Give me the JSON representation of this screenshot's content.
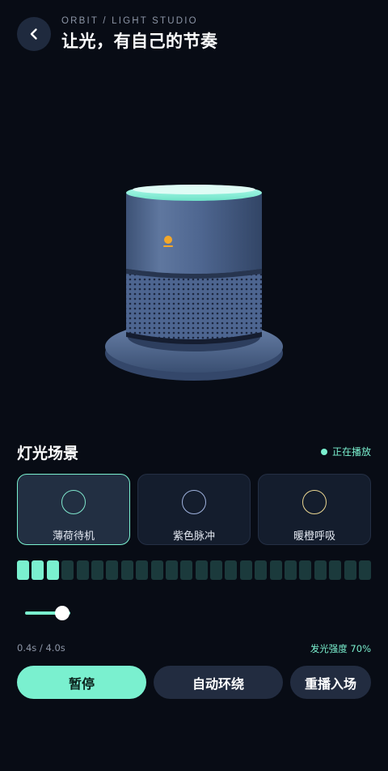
{
  "header": {
    "eyebrow": "ORBIT / LIGHT STUDIO",
    "title": "让光，有自己的节奏"
  },
  "scenes": {
    "title": "灯光场景",
    "status": "正在播放",
    "items": [
      {
        "label": "薄荷待机",
        "ring_color": "#7fe6cc",
        "active": true
      },
      {
        "label": "紫色脉冲",
        "ring_color": "#9fb2de",
        "active": false
      },
      {
        "label": "暖橙呼吸",
        "ring_color": "#e9d590",
        "active": false
      }
    ]
  },
  "timeline": {
    "total_segments": 24,
    "active_segments": 3
  },
  "playback": {
    "time": "0.4s / 4.0s",
    "progress": 0.1,
    "intensity_label": "发光强度 70%"
  },
  "actions": {
    "pause": "暂停",
    "auto_orbit": "自动环绕",
    "replay": "重播入场"
  },
  "colors": {
    "accent": "#7af0cf",
    "background": "#080c15",
    "card": "#141d2d"
  }
}
